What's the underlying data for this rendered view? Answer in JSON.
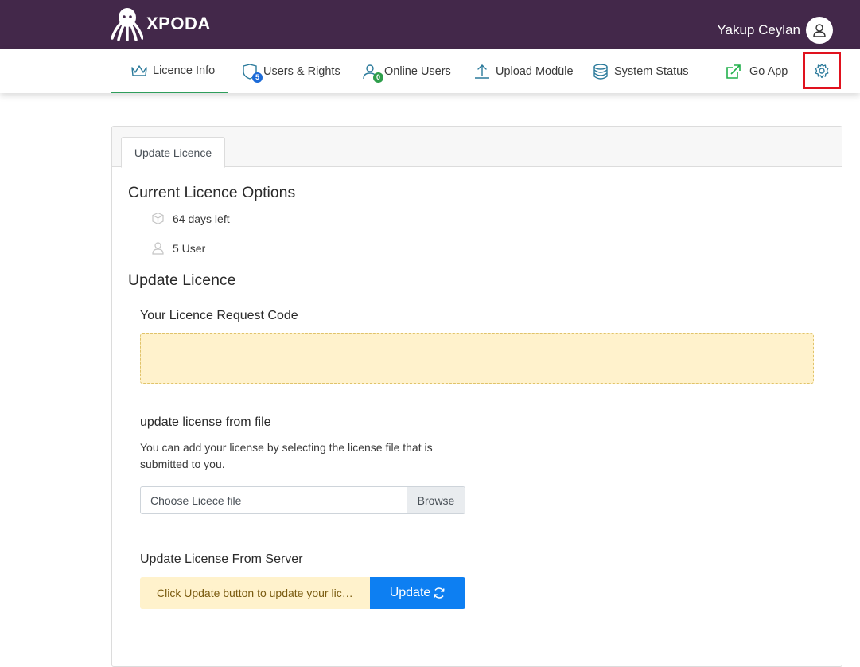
{
  "header": {
    "brand": "XPODA",
    "user_name": "Yakup Ceylan"
  },
  "nav": {
    "items": [
      {
        "label": "Licence Info",
        "icon": "crown-icon",
        "active": true
      },
      {
        "label": "Users & Rights",
        "icon": "users-shield-icon",
        "badge": "5"
      },
      {
        "label": "Online Users",
        "icon": "user-online-icon",
        "badge": "0"
      },
      {
        "label": "Upload Modüle",
        "icon": "upload-icon"
      },
      {
        "label": "System Status",
        "icon": "database-icon"
      },
      {
        "label": "Go App",
        "icon": "external-link-icon"
      }
    ],
    "settings_icon": "gear-icon"
  },
  "card": {
    "tab_label": "Update Licence",
    "current_title": "Current Licence Options",
    "days_left": "64 days left",
    "users": "5 User",
    "update_title": "Update Licence",
    "request_code_label": "Your Licence Request Code",
    "request_code_value": "",
    "file_section_label": "update license from file",
    "file_help": "You can add your license by selecting the license file that is submitted to you.",
    "file_placeholder": "Choose Licece file",
    "browse_label": "Browse",
    "server_section_label": "Update License From Server",
    "server_message": "Click Update button to update your licence",
    "update_button_label": "Update"
  },
  "colors": {
    "header_bg": "#43284a",
    "active_tab_underline": "#2e9e5b",
    "update_button": "#0d7ff2",
    "warning_bg": "#fff2cc",
    "highlight_border": "#e0121e"
  }
}
